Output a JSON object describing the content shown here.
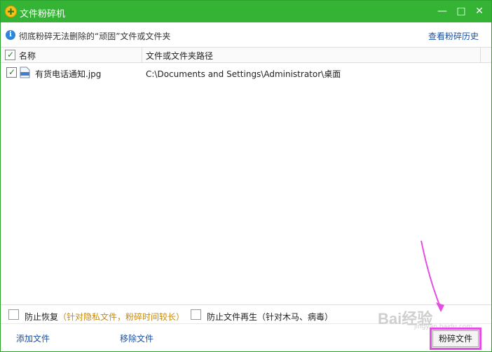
{
  "window": {
    "title": "文件粉碎机",
    "minimize_glyph": "—",
    "maximize_glyph": "□",
    "close_glyph": "✕",
    "accent": "#35b335"
  },
  "infobar": {
    "icon": "info-icon",
    "icon_glyph": "i",
    "text": "彻底粉碎无法删除的“顽固”文件或文件夹",
    "history_link": "查看粉碎历史"
  },
  "table": {
    "columns": [
      "名称",
      "文件或文件夹路径"
    ],
    "rows": [
      {
        "checked": true,
        "name": "有货电话通知.jpg",
        "path": "C:\\Documents and Settings\\Administrator\\桌面"
      }
    ]
  },
  "options": {
    "prevent_recovery": {
      "label": "防止恢复",
      "note": "（针对隐私文件，粉碎时间较长）"
    },
    "prevent_regen": {
      "label": "防止文件再生",
      "note": "（针对木马、病毒）"
    }
  },
  "footer": {
    "add_file": "添加文件",
    "remove_file": "移除文件",
    "shred_button": "粉碎文件",
    "highlight_color": "#e34ee3"
  },
  "watermark": {
    "text": "Bai经验",
    "sub": "jingyan.baidu.com"
  }
}
